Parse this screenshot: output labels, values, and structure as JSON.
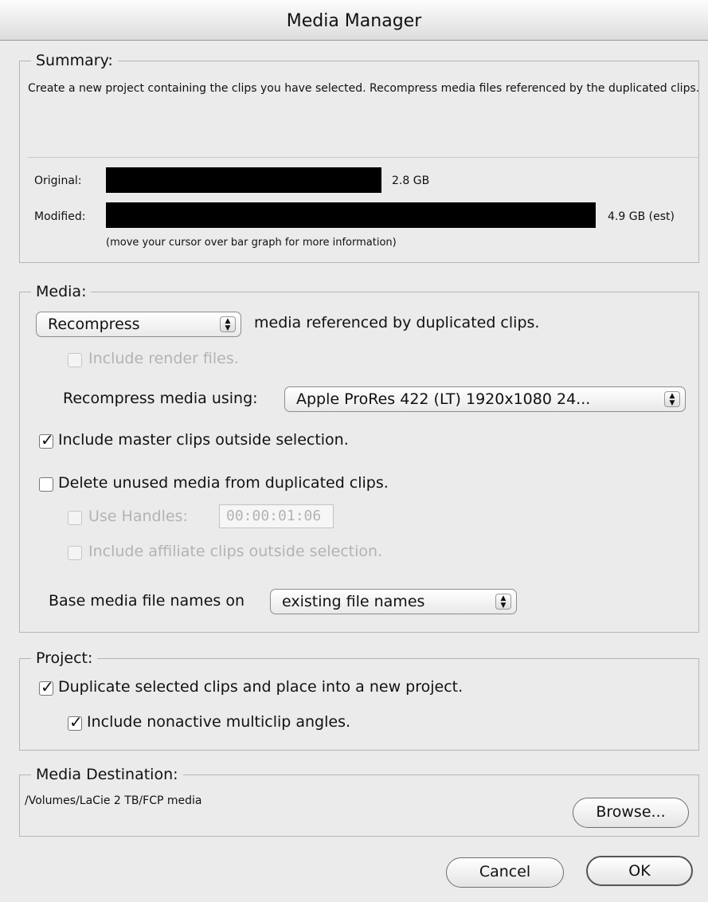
{
  "window": {
    "title": "Media Manager"
  },
  "summary": {
    "legend": "Summary:",
    "text": "Create a new project containing the clips you have selected. Recompress media files referenced by the duplicated clips.",
    "original": {
      "label": "Original:",
      "value": "2.8 GB"
    },
    "modified": {
      "label": "Modified:",
      "value": "4.9 GB (est)"
    },
    "hint": "(move your cursor over bar graph for more information)"
  },
  "media": {
    "legend": "Media:",
    "action_popup": "Recompress",
    "action_suffix": "media referenced by duplicated clips.",
    "include_render_files": "Include render files.",
    "recompress_using_label": "Recompress media using:",
    "recompress_using_value": "Apple ProRes 422 (LT) 1920x1080 24...",
    "include_master_clips": "Include master clips outside selection.",
    "delete_unused": "Delete unused media from duplicated clips.",
    "use_handles": "Use Handles:",
    "handles_value": "00:00:01:06",
    "include_affiliate": "Include affiliate clips outside selection.",
    "base_names_label": "Base media file names on",
    "base_names_value": "existing file names"
  },
  "project": {
    "legend": "Project:",
    "duplicate_clips": "Duplicate selected clips and place into a new project.",
    "include_nonactive": "Include nonactive multiclip angles."
  },
  "destination": {
    "legend": "Media Destination:",
    "path": "/Volumes/LaCie 2 TB/FCP media",
    "browse": "Browse..."
  },
  "buttons": {
    "cancel": "Cancel",
    "ok": "OK"
  }
}
